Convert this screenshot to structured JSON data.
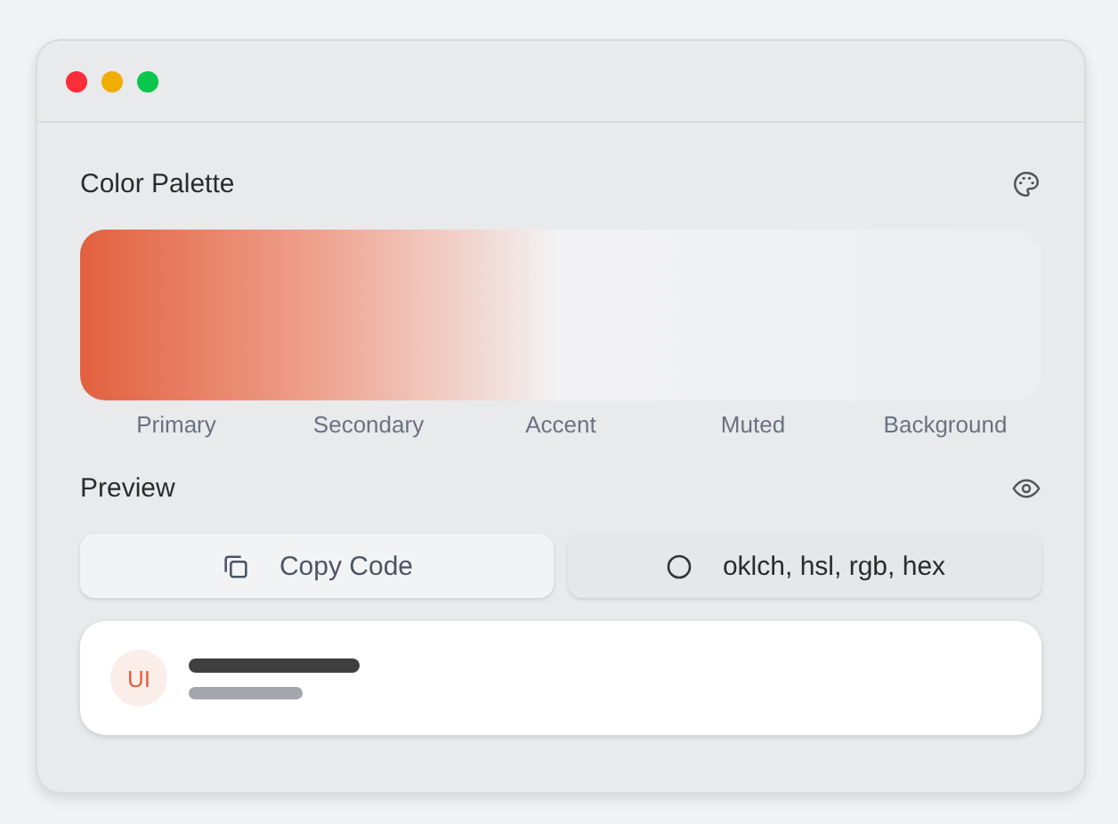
{
  "palette": {
    "title": "Color Palette",
    "swatches": [
      {
        "label": "Primary",
        "color": "#e2603f"
      },
      {
        "label": "Secondary",
        "color": "#efa38f"
      },
      {
        "label": "Accent",
        "color": "#f3f3f5"
      },
      {
        "label": "Muted",
        "color": "#eff0f2"
      },
      {
        "label": "Background",
        "color": "#ebedef"
      }
    ]
  },
  "preview": {
    "title": "Preview",
    "buttons": [
      {
        "label": "Copy Code",
        "kind": "copy"
      },
      {
        "label": "oklch, hsl, rgb, hex",
        "kind": "format"
      }
    ],
    "card": {
      "avatar": "UI"
    }
  }
}
